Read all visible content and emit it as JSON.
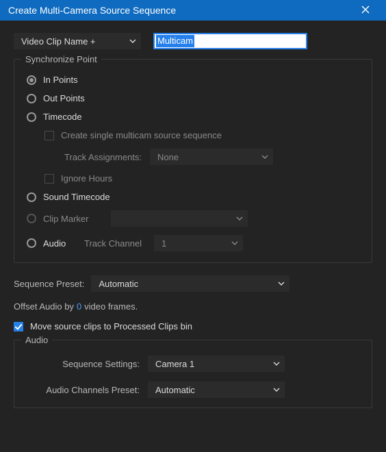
{
  "window": {
    "title": "Create Multi-Camera Source Sequence"
  },
  "top": {
    "name_basis": "Video Clip Name +",
    "name_value": "Multicam"
  },
  "sync": {
    "legend": "Synchronize Point",
    "in_points": "In Points",
    "out_points": "Out Points",
    "timecode": "Timecode",
    "create_single": "Create single multicam source sequence",
    "track_assignments_label": "Track Assignments:",
    "track_assignments_value": "None",
    "ignore_hours": "Ignore Hours",
    "sound_timecode": "Sound Timecode",
    "clip_marker": "Clip Marker",
    "clip_marker_value": "",
    "audio": "Audio",
    "track_channel_label": "Track Channel",
    "track_channel_value": "1"
  },
  "seq": {
    "preset_label": "Sequence Preset:",
    "preset_value": "Automatic",
    "offset_pre": "Offset Audio by",
    "offset_value": "0",
    "offset_post": "video frames.",
    "move_clips": "Move source clips to Processed Clips bin"
  },
  "audio": {
    "legend": "Audio",
    "seq_settings_label": "Sequence Settings:",
    "seq_settings_value": "Camera 1",
    "channels_preset_label": "Audio Channels Preset:",
    "channels_preset_value": "Automatic"
  }
}
